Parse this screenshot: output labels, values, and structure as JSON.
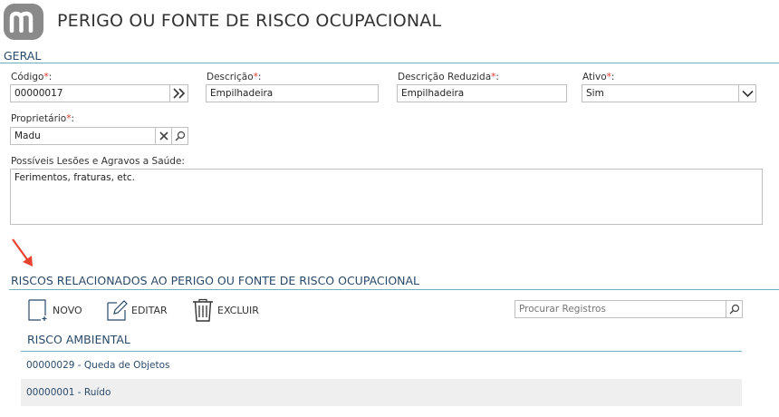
{
  "header": {
    "title": "PERIGO OU FONTE DE RISCO OCUPACIONAL"
  },
  "geral": {
    "section_title": "GERAL",
    "codigo": {
      "label": "Código",
      "value": "00000017"
    },
    "descricao": {
      "label": "Descrição",
      "value": "Empilhadeira"
    },
    "descricao_reduzida": {
      "label": "Descrição Reduzida",
      "value": "Empilhadeira"
    },
    "ativo": {
      "label": "Ativo",
      "value": "Sim"
    },
    "proprietario": {
      "label": "Proprietário",
      "value": "Madu"
    },
    "lesoes": {
      "label": "Possíveis Lesões e Agravos a Saúde:",
      "value": "Ferimentos, fraturas, etc."
    },
    "required_mark": "*",
    "colon": ":"
  },
  "riscos": {
    "section_title": "RISCOS RELACIONADOS AO PERIGO OU FONTE DE RISCO OCUPACIONAL",
    "toolbar": {
      "novo": "NOVO",
      "editar": "EDITAR",
      "excluir": "EXCLUIR"
    },
    "search": {
      "placeholder": "Procurar Registros"
    },
    "group_title": "RISCO AMBIENTAL",
    "rows": [
      {
        "label": "00000029 - Queda de Objetos"
      },
      {
        "label": "00000001 - Ruído"
      }
    ]
  },
  "colors": {
    "accent_line": "#6fb0bf",
    "required": "#e03c31",
    "row_alt": "#efefef",
    "arrow": "#e8432e"
  }
}
